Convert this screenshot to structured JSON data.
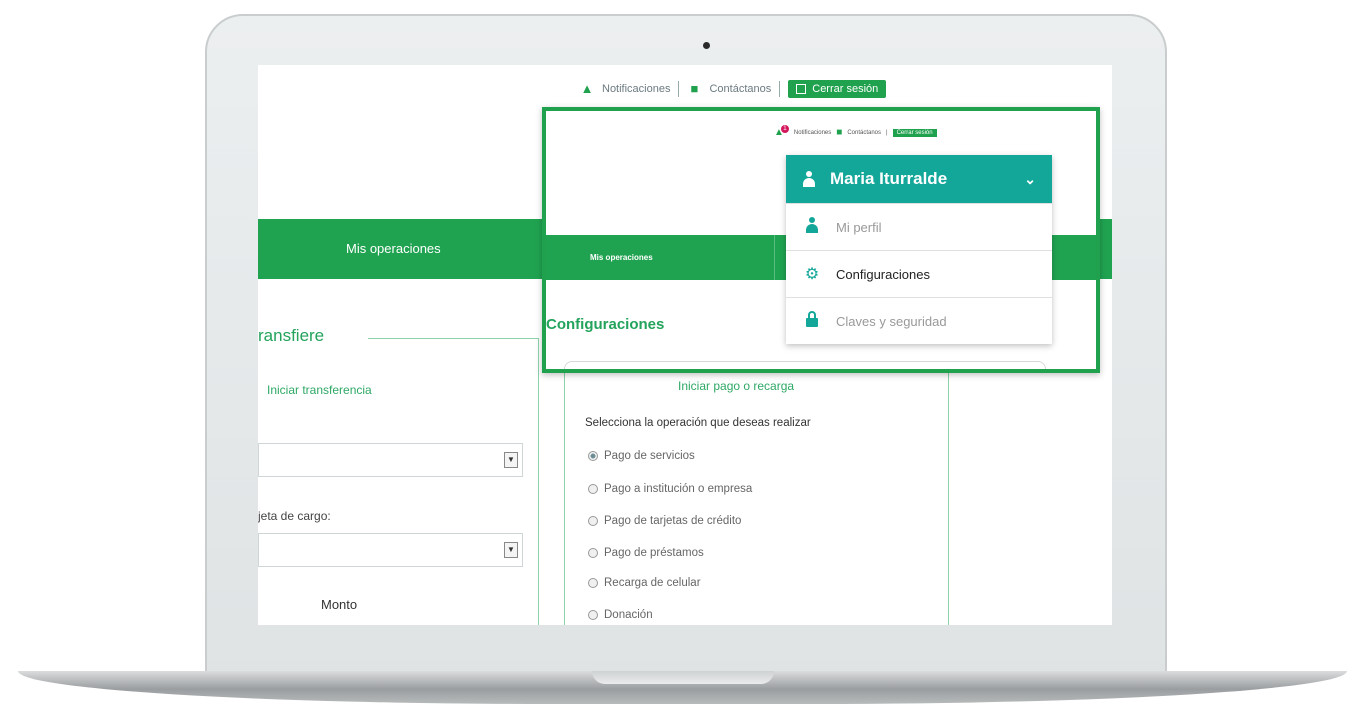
{
  "screen": {
    "topbar": {
      "notifications_label": "Notificaciones",
      "contact_label": "Contáctanos",
      "logout_label": "Cerrar sesión"
    },
    "nav": {
      "tab_label": "Mis operaciones"
    },
    "transfer": {
      "heading": "ransfiere",
      "start_link": "Iniciar transferencia",
      "card_label": "jeta de cargo:",
      "amount_label": "Monto"
    },
    "payment": {
      "start_link": "Iniciar pago o recarga",
      "prompt": "Selecciona la operación que deseas realizar",
      "options": [
        "Pago de servicios",
        "Pago a institución o empresa",
        "Pago de tarjetas de crédito",
        "Pago de préstamos",
        "Recarga de celular",
        "Donación"
      ],
      "selected_index": 0
    }
  },
  "callout": {
    "topbar": {
      "notifications_label": "Notificaciones",
      "notification_count": "1",
      "contact_label": "Contáctanos",
      "logout_label": "Cerrar sesión"
    },
    "nav_tab_label": "Mis operaciones",
    "heading": "Configuraciones",
    "user_menu": {
      "user_name": "Maria Iturralde",
      "items": [
        {
          "label": "Mi perfil",
          "icon": "person-icon"
        },
        {
          "label": "Configuraciones",
          "icon": "gear-icon"
        },
        {
          "label": "Claves y seguridad",
          "icon": "lock-icon"
        }
      ]
    }
  },
  "colors": {
    "brand_green": "#20a351",
    "teal": "#13a79a",
    "highlight_border": "#1fa14d",
    "badge": "#d4185e"
  }
}
